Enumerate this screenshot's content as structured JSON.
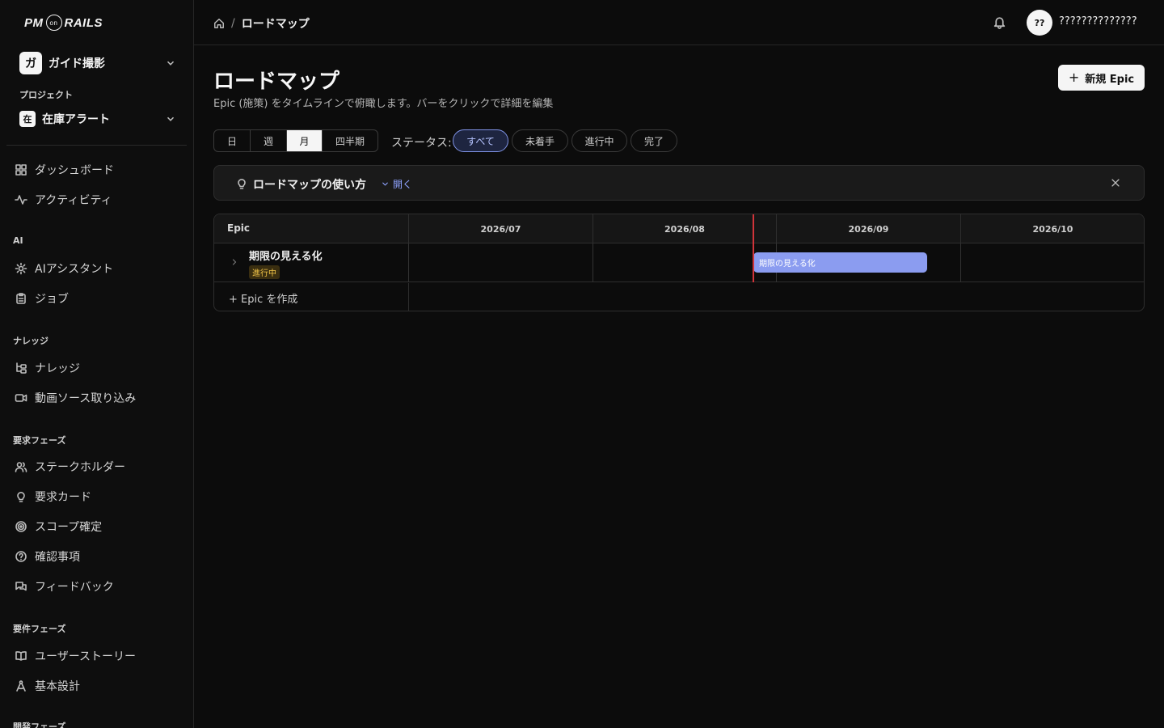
{
  "logo": {
    "left": "PM",
    "ring": "on",
    "right": "RAILS"
  },
  "workspace": {
    "badge": "ガ",
    "name": "ガイド撮影"
  },
  "project": {
    "heading": "プロジェクト",
    "badge": "在",
    "name": "在庫アラート"
  },
  "sidebar": {
    "top_items": [
      {
        "label": "ダッシュボード",
        "icon": "grid-icon"
      },
      {
        "label": "アクティビティ",
        "icon": "activity-icon"
      }
    ],
    "sections": [
      {
        "title": "AI",
        "items": [
          {
            "label": "AIアシスタント",
            "icon": "gear-icon"
          },
          {
            "label": "ジョブ",
            "icon": "clipboard-icon"
          }
        ]
      },
      {
        "title": "ナレッジ",
        "items": [
          {
            "label": "ナレッジ",
            "icon": "tree-icon"
          },
          {
            "label": "動画ソース取り込み",
            "icon": "video-icon"
          }
        ]
      },
      {
        "title": "要求フェーズ",
        "items": [
          {
            "label": "ステークホルダー",
            "icon": "users-icon"
          },
          {
            "label": "要求カード",
            "icon": "bulb-icon"
          },
          {
            "label": "スコープ確定",
            "icon": "target-icon"
          },
          {
            "label": "確認事項",
            "icon": "question-icon"
          },
          {
            "label": "フィードバック",
            "icon": "chat-icon"
          }
        ]
      },
      {
        "title": "要件フェーズ",
        "items": [
          {
            "label": "ユーザーストーリー",
            "icon": "book-icon"
          },
          {
            "label": "基本設計",
            "icon": "compass-icon"
          }
        ]
      },
      {
        "title": "開発フェーズ",
        "items": []
      }
    ]
  },
  "header": {
    "breadcrumb_current": "ロードマップ",
    "breadcrumb_sep": "/",
    "avatar_initials": "??",
    "user_name": "??????????????"
  },
  "main": {
    "title": "ロードマップ",
    "subtitle": "Epic (施策) をタイムラインで俯瞰します。バーをクリックで詳細を編集",
    "new_epic_label": "新規 Epic",
    "new_epic_plus": "+",
    "scale_tabs": [
      "日",
      "週",
      "月",
      "四半期"
    ],
    "scale_selected": "月",
    "status_label": "ステータス:",
    "status_filters": [
      "すべて",
      "未着手",
      "進行中",
      "完了"
    ],
    "status_selected": "すべて"
  },
  "hint": {
    "title": "ロードマップの使い方",
    "toggle": "開く"
  },
  "timeline": {
    "epic_column": "Epic",
    "months": [
      "2026/07",
      "2026/08",
      "2026/09",
      "2026/10"
    ],
    "epics": [
      {
        "name": "期限の見える化",
        "status": "進行中",
        "bar_label": "期限の見える化"
      }
    ],
    "create_label": "+ Epic を作成"
  },
  "colors": {
    "accent": "#8b9cf0",
    "today_line": "#d0343a",
    "status_in_progress": "#f2c548"
  }
}
